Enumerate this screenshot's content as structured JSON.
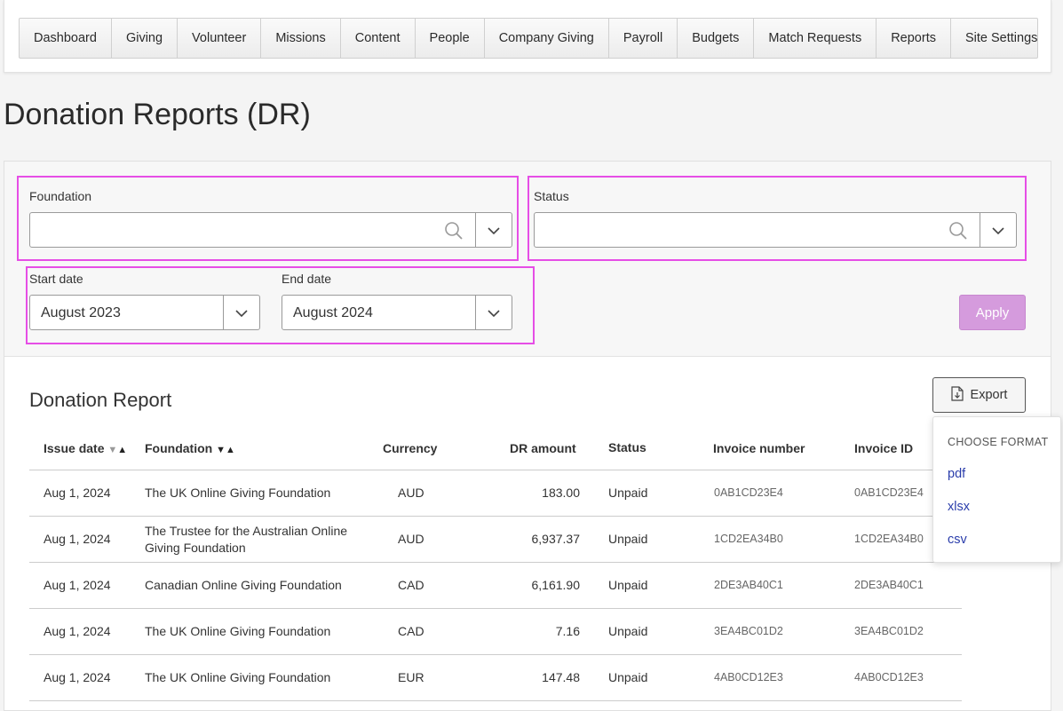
{
  "nav": {
    "items": [
      "Dashboard",
      "Giving",
      "Volunteer",
      "Missions",
      "Content",
      "People",
      "Company Giving",
      "Payroll",
      "Budgets",
      "Match Requests",
      "Reports",
      "Site Settings"
    ]
  },
  "page": {
    "title": "Donation Reports (DR)"
  },
  "filters": {
    "foundation_label": "Foundation",
    "foundation_value": "",
    "status_label": "Status",
    "status_value": "",
    "start_label": "Start date",
    "start_value": "August 2023",
    "end_label": "End date",
    "end_value": "August 2024",
    "apply_label": "Apply",
    "apply_color": "#d59bdd"
  },
  "report": {
    "title": "Donation Report",
    "export_label": "Export",
    "columns": {
      "issue_date": "Issue date",
      "foundation": "Foundation",
      "currency": "Currency",
      "amount": "DR amount",
      "status": "Status",
      "invoice_number": "Invoice number",
      "invoice_id": "Invoice ID"
    },
    "rows": [
      {
        "date": "Aug 1, 2024",
        "foundation": "The UK Online Giving Foundation",
        "currency": "AUD",
        "amount": "183.00",
        "status": "Unpaid",
        "invoice_number": "0AB1CD23E4",
        "invoice_id": "0AB1CD23E4"
      },
      {
        "date": "Aug 1, 2024",
        "foundation": "The Trustee for the Australian Online Giving Foundation",
        "currency": "AUD",
        "amount": "6,937.37",
        "status": "Unpaid",
        "invoice_number": "1CD2EA34B0",
        "invoice_id": "1CD2EA34B0"
      },
      {
        "date": "Aug 1, 2024",
        "foundation": "Canadian Online Giving Foundation",
        "currency": "CAD",
        "amount": "6,161.90",
        "status": "Unpaid",
        "invoice_number": "2DE3AB40C1",
        "invoice_id": "2DE3AB40C1"
      },
      {
        "date": "Aug 1, 2024",
        "foundation": "The UK Online Giving Foundation",
        "currency": "CAD",
        "amount": "7.16",
        "status": "Unpaid",
        "invoice_number": "3EA4BC01D2",
        "invoice_id": "3EA4BC01D2"
      },
      {
        "date": "Aug 1, 2024",
        "foundation": "The UK Online Giving Foundation",
        "currency": "EUR",
        "amount": "147.48",
        "status": "Unpaid",
        "invoice_number": "4AB0CD12E3",
        "invoice_id": "4AB0CD12E3"
      }
    ]
  },
  "export_menu": {
    "header": "CHOOSE FORMAT",
    "options": [
      "pdf",
      "xlsx",
      "csv"
    ],
    "link_color": "#2a3dab"
  },
  "highlight_color": "#e64ee6"
}
